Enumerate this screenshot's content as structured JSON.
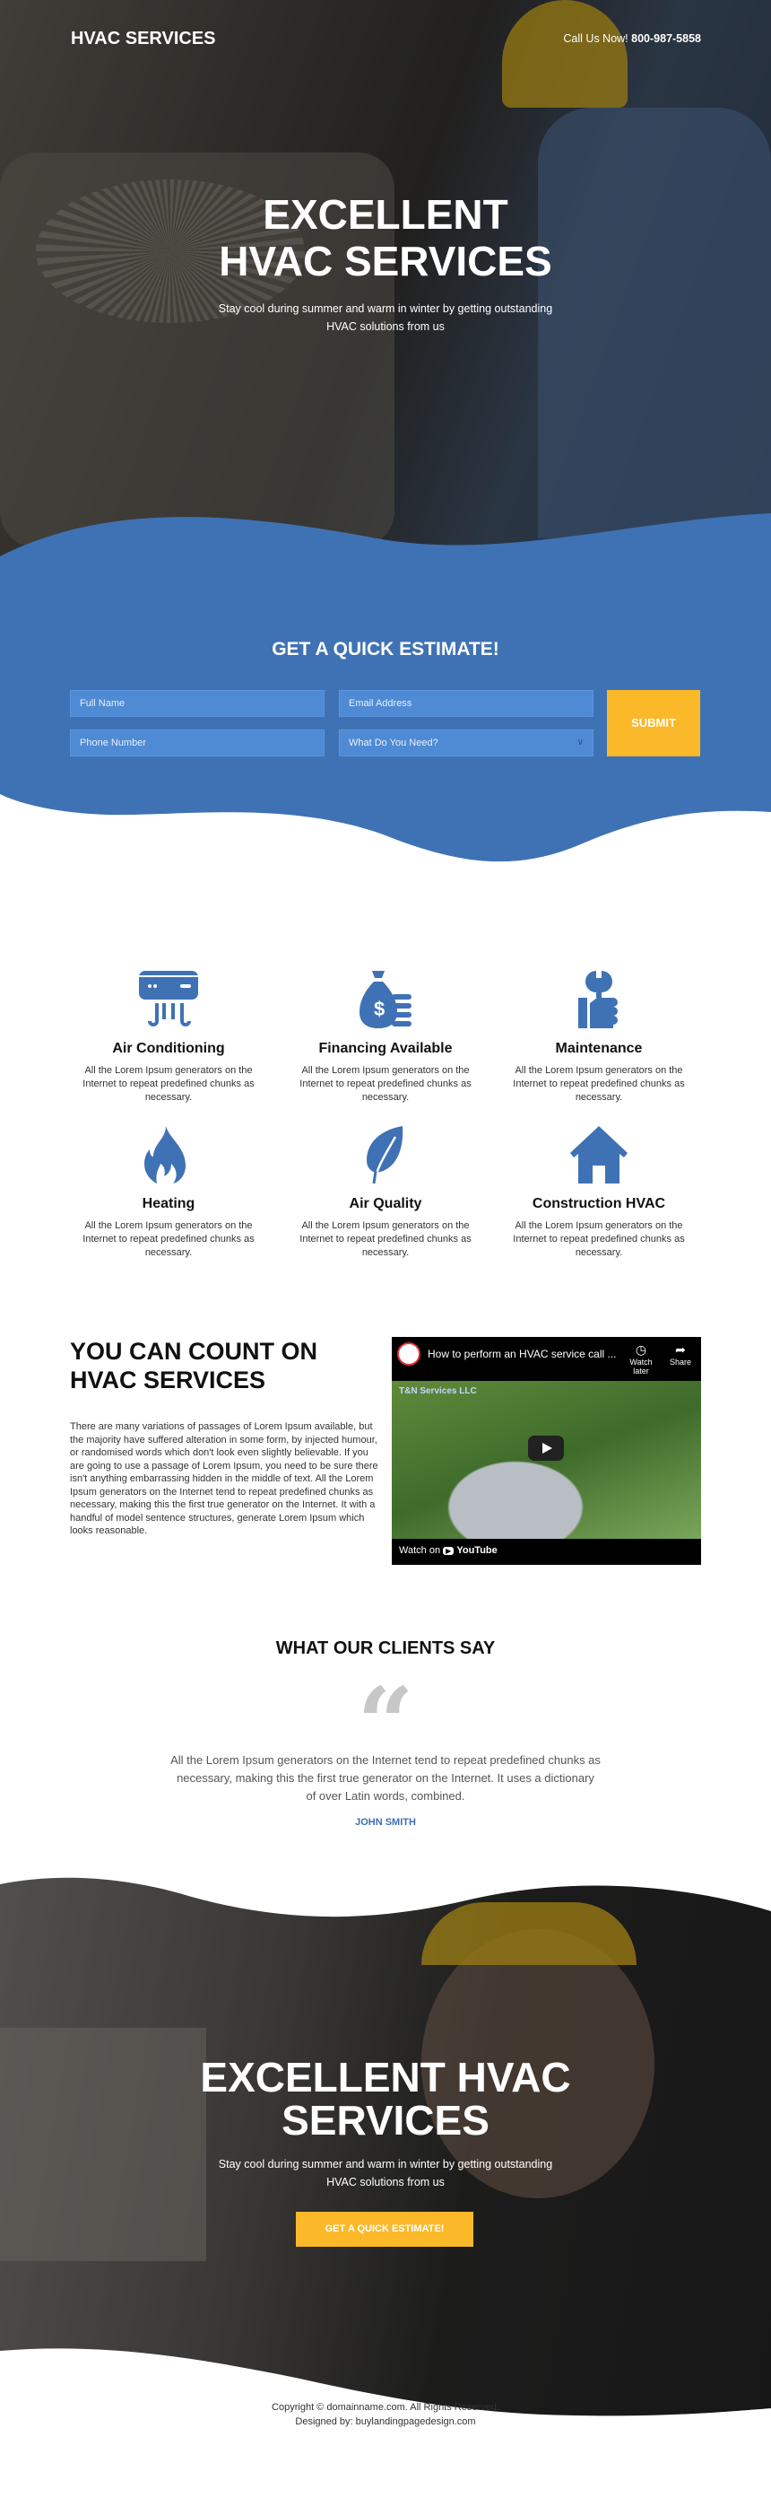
{
  "header": {
    "logo": "HVAC SERVICES",
    "call_label": "Call Us Now!",
    "phone": "800-987-5858"
  },
  "hero": {
    "title_line1": "EXCELLENT",
    "title_line2": "HVAC SERVICES",
    "subtitle": "Stay cool during summer and warm in winter by getting outstanding HVAC solutions from us"
  },
  "estimate_form": {
    "title": "GET A QUICK ESTIMATE!",
    "full_name_placeholder": "Full Name",
    "email_placeholder": "Email Address",
    "phone_placeholder": "Phone Number",
    "need_select": "What Do You Need?",
    "submit_label": "SUBMIT"
  },
  "colors": {
    "primary_blue": "#3f72b4",
    "field_blue": "#4f8ad4",
    "accent_yellow": "#fbb829"
  },
  "services": [
    {
      "icon": "air-conditioner-icon",
      "title": "Air Conditioning",
      "desc": "All the Lorem Ipsum generators on the Internet to repeat predefined chunks as necessary."
    },
    {
      "icon": "money-bag-icon",
      "title": "Financing Available",
      "desc": "All the Lorem Ipsum generators on the Internet to repeat predefined chunks as necessary."
    },
    {
      "icon": "wrench-thumb-icon",
      "title": "Maintenance",
      "desc": "All the Lorem Ipsum generators on the Internet to repeat predefined chunks as necessary."
    },
    {
      "icon": "flame-icon",
      "title": "Heating",
      "desc": "All the Lorem Ipsum generators on the Internet to repeat predefined chunks as necessary."
    },
    {
      "icon": "leaf-icon",
      "title": "Air Quality",
      "desc": "All the Lorem Ipsum generators on the Internet to repeat predefined chunks as necessary."
    },
    {
      "icon": "house-icon",
      "title": "Construction HVAC",
      "desc": "All the Lorem Ipsum generators on the Internet to repeat predefined chunks as necessary."
    }
  ],
  "count_on": {
    "title_line1": "YOU CAN COUNT ON",
    "title_line2": "HVAC SERVICES",
    "body": "There are many variations of passages of Lorem Ipsum available, but the majority have suffered alteration in some form, by injected humour, or randomised words which don't look even slightly believable. If you are going to use a passage of Lorem Ipsum, you need to be sure there isn't anything embarrassing hidden in the middle of text. All the Lorem Ipsum generators on the Internet tend to repeat predefined chunks as necessary, making this the first true generator on the Internet. It with a handful of model sentence structures, generate Lorem Ipsum which looks reasonable."
  },
  "video": {
    "title": "How to perform an HVAC service call ...",
    "watch_later": "Watch later",
    "share": "Share",
    "watch_on": "Watch on",
    "youtube": "YouTube",
    "overlay_text": "T&N Services LLC"
  },
  "testimonials": {
    "title": "WHAT OUR CLIENTS SAY",
    "quote": "All the Lorem Ipsum generators on the Internet tend to repeat predefined chunks as necessary, making this the first true generator on the Internet. It uses a dictionary of over Latin words, combined.",
    "author": "JOHN SMITH"
  },
  "cta_hero": {
    "title_line1": "EXCELLENT HVAC",
    "title_line2": "SERVICES",
    "subtitle": "Stay cool during summer and warm in winter by getting outstanding HVAC solutions from us",
    "button": "GET A QUICK ESTIMATE!"
  },
  "footer": {
    "copyright": "Copyright © domainname.com. All Rights Reserved.",
    "designed_by": "Designed by: buylandingpagedesign.com"
  }
}
